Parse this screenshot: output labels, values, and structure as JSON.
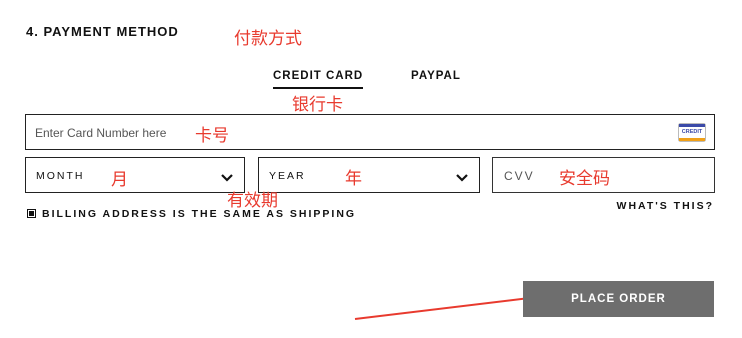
{
  "section": {
    "title": "4. PAYMENT METHOD"
  },
  "annotations": {
    "payment_method": "付款方式",
    "credit_card": "银行卡",
    "card_number": "卡号",
    "month": "月",
    "year": "年",
    "validity": "有效期",
    "cvv": "安全码"
  },
  "tabs": [
    {
      "label": "CREDIT CARD",
      "active": true
    },
    {
      "label": "PAYPAL",
      "active": false
    }
  ],
  "card_number": {
    "placeholder": "Enter Card Number here",
    "value": "",
    "icon": "credit-card-icon",
    "icon_text": "CREDIT"
  },
  "expiry": {
    "month": {
      "selected": "MONTH"
    },
    "year": {
      "selected": "YEAR"
    }
  },
  "cvv": {
    "placeholder": "CVV"
  },
  "whats_this": "WHAT'S THIS?",
  "billing": {
    "label": "BILLING ADDRESS IS THE SAME AS SHIPPING",
    "checked": true
  },
  "place_order": {
    "label": "PLACE ORDER"
  },
  "colors": {
    "annotation": "#e83a2e",
    "button_bg": "#6e6e6e",
    "border": "#222222",
    "card_icon_blue": "#3b4aa8",
    "card_icon_orange": "#f0a018"
  }
}
